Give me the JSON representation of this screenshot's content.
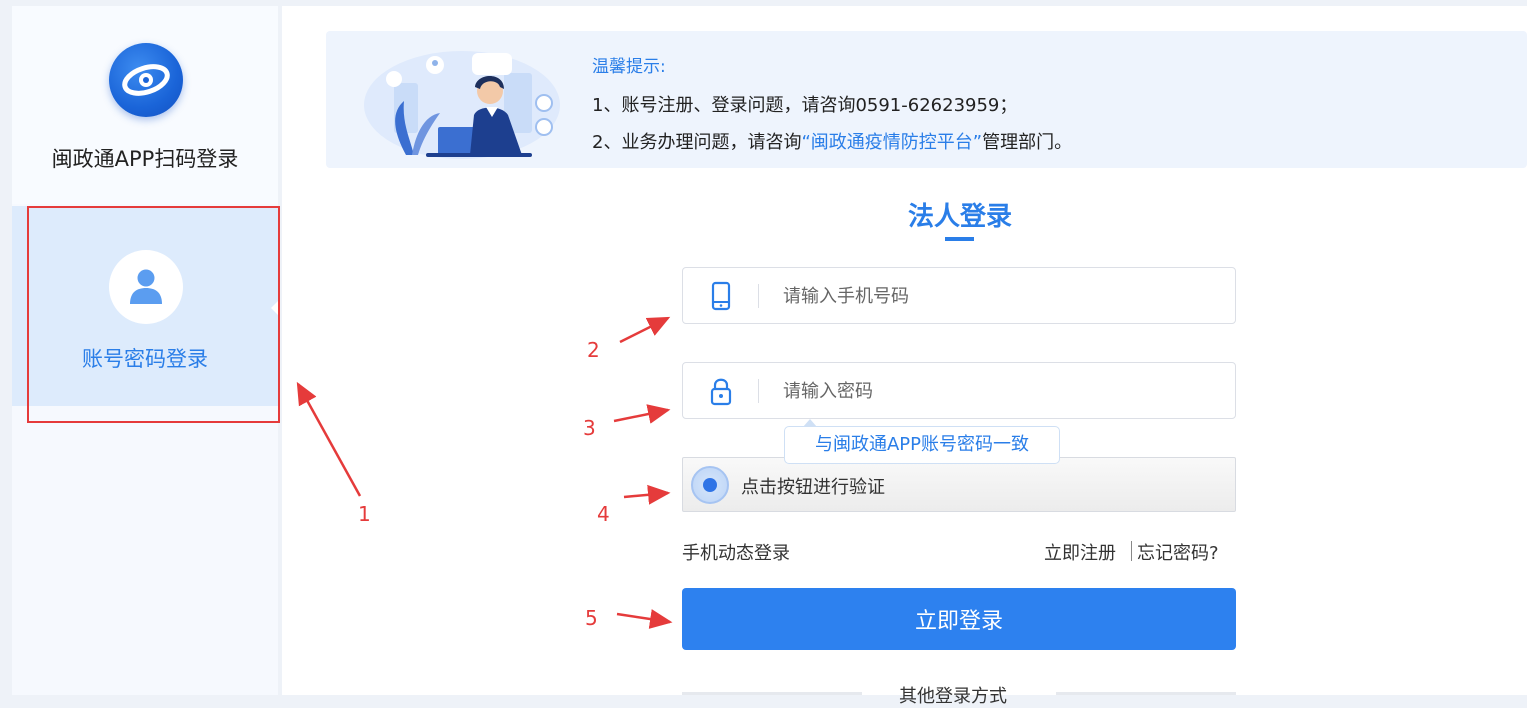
{
  "sidebar": {
    "qr_tab": {
      "label": "闽政通APP扫码登录",
      "icon": "minzhengtong-logo-icon"
    },
    "pwd_tab": {
      "label": "账号密码登录",
      "icon": "user-avatar-icon",
      "active": true
    }
  },
  "notice": {
    "title": "温馨提示:",
    "line1": "1、账号注册、登录问题，请咨询0591-62623959；",
    "line2_prefix": "2、业务办理问题，请咨询",
    "line2_highlight": "“闽政通疫情防控平台”",
    "line2_suffix": "管理部门。",
    "illustration": "customer-service-illustration"
  },
  "form": {
    "title": "法人登录",
    "phone": {
      "placeholder": "请输入手机号码",
      "value": "",
      "icon": "mobile-phone-icon"
    },
    "password": {
      "placeholder": "请输入密码",
      "value": "",
      "icon": "lock-icon"
    },
    "tooltip": "与闽政通APP账号密码一致",
    "verify_text": "点击按钮进行验证",
    "links": {
      "sms_login": "手机动态登录",
      "register": "立即注册",
      "forgot": "忘记密码?"
    },
    "login_button": "立即登录",
    "other_methods": "其他登录方式"
  },
  "annotations": {
    "labels": [
      "1",
      "2",
      "3",
      "4",
      "5"
    ],
    "color": "#e53b3b"
  },
  "colors": {
    "accent": "#2a7ee8",
    "button": "#2d81ef",
    "annotation": "#e53b3b"
  }
}
